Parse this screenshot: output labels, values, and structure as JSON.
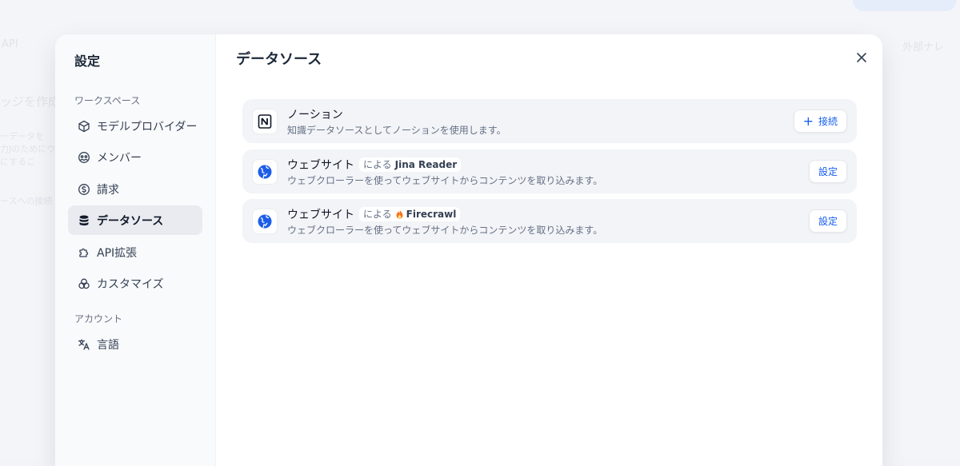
{
  "background": {
    "fragments": [
      "API",
      "ッジを作成",
      "ーデータを",
      "力Jのためにウェ",
      "にするこ",
      "ースへの接続",
      "外部ナレ"
    ]
  },
  "sidebar": {
    "title": "設定",
    "groups": [
      {
        "label": "ワークスペース"
      },
      {
        "label": "アカウント"
      }
    ],
    "items": [
      {
        "label": "モデルプロバイダー",
        "icon": "cube-icon",
        "active": false
      },
      {
        "label": "メンバー",
        "icon": "members-icon",
        "active": false
      },
      {
        "label": "請求",
        "icon": "billing-icon",
        "active": false
      },
      {
        "label": "データソース",
        "icon": "database-icon",
        "active": true
      },
      {
        "label": "API拡張",
        "icon": "puzzle-icon",
        "active": false
      },
      {
        "label": "カスタマイズ",
        "icon": "customize-icon",
        "active": false
      },
      {
        "label": "言語",
        "icon": "translate-icon",
        "active": false
      }
    ]
  },
  "main": {
    "title": "データソース",
    "sources": [
      {
        "name": "ノーション",
        "provider_prefix": "",
        "provider": "",
        "description": "知識データソースとしてノーションを使用します。",
        "button": "接続",
        "icon": "notion-icon"
      },
      {
        "name": "ウェブサイト",
        "provider_prefix": "による",
        "provider": "Jina Reader",
        "description": "ウェブクローラーを使ってウェブサイトからコンテンツを取り込みます。",
        "button": "設定",
        "icon": "website-icon"
      },
      {
        "name": "ウェブサイト",
        "provider_prefix": "による",
        "provider": "Firecrawl",
        "description": "ウェブクローラーを使ってウェブサイトからコンテンツを取り込みます。",
        "button": "設定",
        "icon": "website-icon"
      }
    ]
  },
  "colors": {
    "accent": "#155eef",
    "active_bg": "#e9ebf0",
    "card_bg": "#f2f4f7"
  }
}
